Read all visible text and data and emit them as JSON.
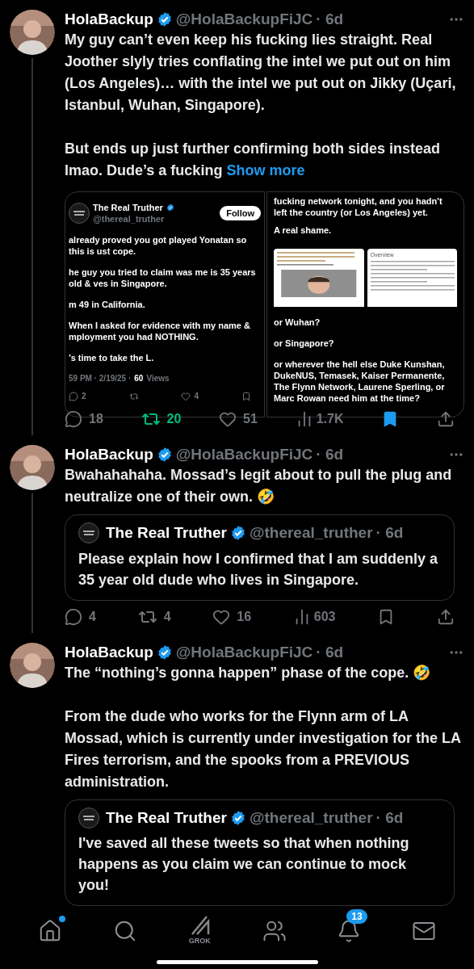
{
  "tweets": [
    {
      "author": "HolaBackup",
      "verified": true,
      "handle": "@HolaBackupFiJC",
      "time": "· 6d",
      "text": "My guy can’t even keep his fucking lies straight. Real Joother slyly tries conflating the intel we put out on him (Los Angeles)… with the intel we put out on Jikky (Uçari, Istanbul, Wuhan, Singapore).\n\nBut ends up just further confirming both sides instead lmao. Dude’s a fucking",
      "show_more": "Show more",
      "media": [
        {
          "kind": "tweet_shot",
          "author": "The Real Truther",
          "handle": "@thereal_truther",
          "follow": "Follow",
          "paragraphs": [
            "already proved you got played Yonatan so this is ust cope.",
            "he guy you tried to claim was me is 35 years old & ves in Singapore.",
            "m 49 in California.",
            "When I asked for evidence with my name & mployment you had NOTHING.",
            "’s time to take the L."
          ],
          "meta": "59 PM · 2/19/25 ·",
          "views": "60",
          "views_label": "Views",
          "replies": "2",
          "likes": "4"
        },
        {
          "kind": "text_shot",
          "top": "fucking network tonight, and you hadn't left the country (or Los Angeles) yet.",
          "shame": "A real shame.",
          "inset_heading": "Overview",
          "paragraphs": [
            "or Wuhan?",
            "or Singapore?",
            "or wherever the hell else Duke Kunshan, DukeNUS, Temasek, Kaiser Permanente, The Flynn Network, Laurene Sperling, or Marc Rowan need him at the time?"
          ]
        }
      ],
      "actions": {
        "replies": "18",
        "reposts": "20",
        "reposted": true,
        "likes": "51",
        "liked": false,
        "views": "1.7K",
        "bookmarked": true
      }
    },
    {
      "author": "HolaBackup",
      "verified": true,
      "handle": "@HolaBackupFiJC",
      "time": "· 6d",
      "text": "Bwahahahaha. Mossad’s legit about to pull the plug and neutralize one of their own. 🤣",
      "quote": {
        "author": "The Real Truther",
        "verified": true,
        "handle": "@thereal_truther",
        "time": "· 6d",
        "text": "Please explain how I confirmed that I am suddenly a 35 year old dude who lives in Singapore."
      },
      "actions": {
        "replies": "4",
        "reposts": "4",
        "reposted": false,
        "likes": "16",
        "liked": false,
        "views": "603",
        "bookmarked": false
      }
    },
    {
      "author": "HolaBackup",
      "verified": true,
      "handle": "@HolaBackupFiJC",
      "time": "· 6d",
      "text": "The “nothing’s gonna happen” phase of the cope. 🤣\n\nFrom the dude who works for the Flynn arm of LA Mossad, which is currently under investigation for the LA Fires terrorism, and the spooks from a PREVIOUS administration.",
      "quote": {
        "author": "The Real Truther",
        "verified": true,
        "handle": "@thereal_truther",
        "time": "· 6d",
        "text": "I've saved all these tweets so that when nothing happens as you claim we can continue to mock you!"
      }
    }
  ],
  "nav": [
    {
      "kind": "home",
      "unread": true
    },
    {
      "kind": "search",
      "unread": false
    },
    {
      "kind": "grok",
      "unread": false,
      "label": "GROK"
    },
    {
      "kind": "people",
      "unread": false
    },
    {
      "kind": "bell",
      "unread": false,
      "badge": "13"
    },
    {
      "kind": "mail",
      "unread": false
    }
  ]
}
